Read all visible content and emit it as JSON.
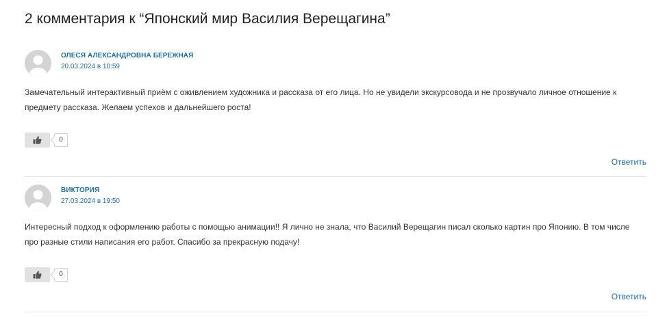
{
  "comments_section": {
    "title": "2 комментария к “Японский мир Василия Верещагина”"
  },
  "comments": [
    {
      "author": "ОЛЕСЯ АЛЕКСАНДРОВНА БЕРЕЖНАЯ",
      "date": "20.03.2024 в 10:59",
      "text": "Замечательный интерактивный приём с оживлением художника и рассказа от его лица. Но не увидели экскурсовода и не прозвучало личное отношение к предмету рассказа. Желаем успехов и дальнейшего роста!",
      "like_icon": "thumbs-up-icon",
      "likes": "0",
      "reply_label": "Ответить"
    },
    {
      "author": "ВИКТОРИЯ",
      "date": "27.03.2024 в 19:50",
      "text": "Интересный подход к оформлению работы с помощью анимации!! Я лично не знала, что Василий Верещагин писал сколько картин про Японию. В том числе про разные стили написания его работ. Спасибо за прекрасную подачу!",
      "like_icon": "thumbs-up-icon",
      "likes": "0",
      "reply_label": "Ответить"
    }
  ],
  "colors": {
    "link": "#1a6da8",
    "text": "#333333",
    "avatar_bg": "#d4d4d4",
    "like_button_bg": "#e2e2e2"
  }
}
